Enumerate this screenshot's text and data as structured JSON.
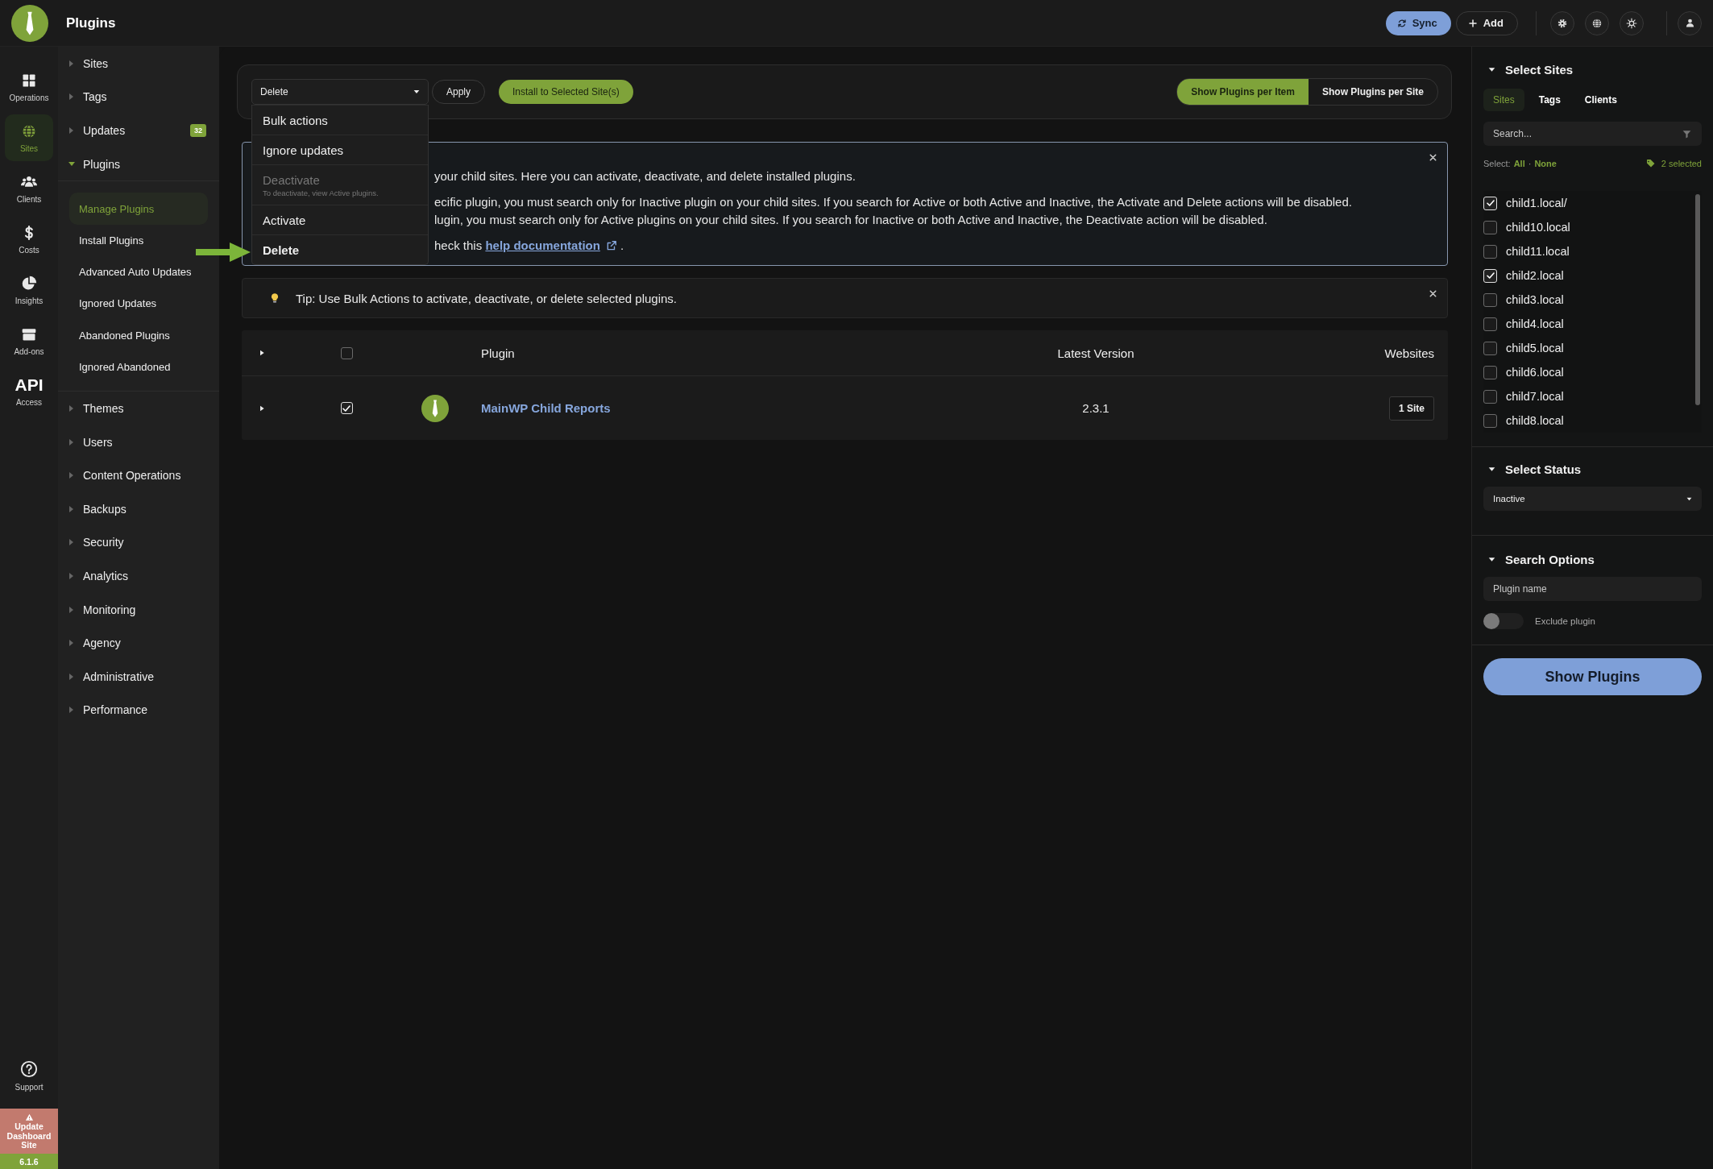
{
  "header": {
    "title": "Plugins",
    "buttons": [
      {
        "label": "Sync",
        "kind": "primary"
      },
      {
        "label": "Add",
        "kind": "secondary"
      }
    ]
  },
  "rail": {
    "items": [
      {
        "label": "Operations",
        "selected": false
      },
      {
        "label": "Sites",
        "selected": true
      },
      {
        "label": "Clients",
        "selected": false
      },
      {
        "label": "Costs",
        "selected": false
      },
      {
        "label": "Insights",
        "selected": false
      },
      {
        "label": "Add-ons",
        "selected": false
      }
    ],
    "api": {
      "glyph": "API",
      "label": "Access"
    },
    "support": "Support",
    "update_notice": "Update Dashboard Site",
    "version": "6.1.6"
  },
  "nav": {
    "items": [
      {
        "label": "Sites",
        "expanded": false
      },
      {
        "label": "Tags",
        "expanded": false
      },
      {
        "label": "Updates",
        "expanded": false,
        "badge": "32"
      },
      {
        "label": "Plugins",
        "expanded": true,
        "children": [
          {
            "label": "Manage Plugins",
            "selected": true
          },
          {
            "label": "Install Plugins",
            "selected": false
          },
          {
            "label": "Advanced Auto Updates",
            "selected": false
          },
          {
            "label": "Ignored Updates",
            "selected": false
          },
          {
            "label": "Abandoned Plugins",
            "selected": false
          },
          {
            "label": "Ignored Abandoned",
            "selected": false
          }
        ]
      },
      {
        "label": "Themes",
        "expanded": false
      },
      {
        "label": "Users",
        "expanded": false
      },
      {
        "label": "Content Operations",
        "expanded": false
      },
      {
        "label": "Backups",
        "expanded": false
      },
      {
        "label": "Security",
        "expanded": false
      },
      {
        "label": "Analytics",
        "expanded": false
      },
      {
        "label": "Monitoring",
        "expanded": false
      },
      {
        "label": "Agency",
        "expanded": false
      },
      {
        "label": "Administrative",
        "expanded": false
      },
      {
        "label": "Performance",
        "expanded": false
      }
    ]
  },
  "toolbar": {
    "bulk_select": "Delete",
    "bulk_menu": {
      "open": true,
      "options": [
        {
          "label": "Bulk actions",
          "selected": false,
          "disabled": false
        },
        {
          "label": "Ignore updates",
          "selected": false,
          "disabled": false
        },
        {
          "label": "Deactivate",
          "note": "To deactivate, view Active plugins.",
          "selected": false,
          "disabled": true
        },
        {
          "label": "Activate",
          "selected": false,
          "disabled": false
        },
        {
          "label": "Delete",
          "selected": true,
          "disabled": false
        }
      ]
    },
    "apply": "Apply",
    "install": "Install to Selected Site(s)",
    "view_toggle": [
      {
        "label": "Show Plugins per Item",
        "selected": true
      },
      {
        "label": "Show Plugins per Site",
        "selected": false
      }
    ]
  },
  "notice": {
    "lines": [
      "your child sites. Here you can activate, deactivate, and delete installed plugins.",
      "ecific plugin, you must search only for Inactive plugin on your child sites. If you search for Active or both Active and Inactive, the Activate and Delete actions will be disabled.",
      "lugin, you must search only for Active plugins on your child sites. If you search for Inactive or both Active and Inactive, the Deactivate action will be disabled."
    ],
    "help": {
      "before": "heck this",
      "link": "help documentation",
      "after": "."
    }
  },
  "tip": "Tip: Use Bulk Actions to activate, deactivate, or delete selected plugins.",
  "table": {
    "columns": [
      "Plugin",
      "Latest Version",
      "Websites"
    ],
    "header_checked": false,
    "rows": [
      {
        "name": "MainWP Child Reports",
        "version": "2.3.1",
        "websites": "1 Site",
        "checked": true
      }
    ]
  },
  "filters": {
    "select_sites": {
      "title": "Select Sites",
      "tabs": [
        {
          "label": "Sites",
          "selected": true
        },
        {
          "label": "Tags",
          "selected": false
        },
        {
          "label": "Clients",
          "selected": false
        }
      ],
      "placeholder": "Search...",
      "select_label": "Select:",
      "all": "All",
      "separator": "·",
      "none": "None",
      "selected_count": "2 selected",
      "sites": [
        {
          "name": "child1.local/",
          "checked": true
        },
        {
          "name": "child10.local",
          "checked": false
        },
        {
          "name": "child11.local",
          "checked": false
        },
        {
          "name": "child2.local",
          "checked": true
        },
        {
          "name": "child3.local",
          "checked": false
        },
        {
          "name": "child4.local",
          "checked": false
        },
        {
          "name": "child5.local",
          "checked": false
        },
        {
          "name": "child6.local",
          "checked": false
        },
        {
          "name": "child7.local",
          "checked": false
        },
        {
          "name": "child8.local",
          "checked": false
        }
      ]
    },
    "select_status": {
      "title": "Select Status",
      "value": "Inactive"
    },
    "search_options": {
      "title": "Search Options",
      "placeholder": "Plugin name",
      "toggle": {
        "label": "Exclude plugin",
        "on": false
      }
    },
    "show_button": "Show Plugins"
  }
}
